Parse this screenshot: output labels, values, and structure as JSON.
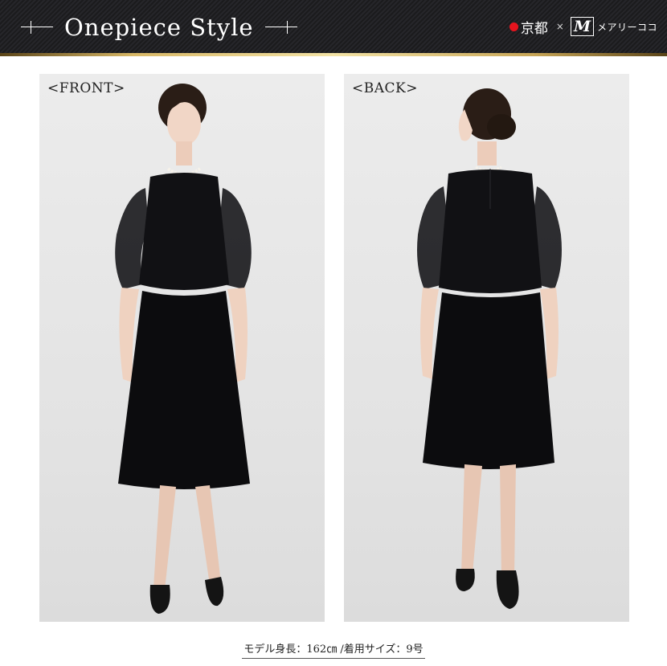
{
  "header": {
    "title": "Onepiece Style",
    "brand_city": "京都",
    "brand_separator": "×",
    "brand_logo_letter": "M",
    "brand_name": "メアリーココ"
  },
  "panels": [
    {
      "label": "<FRONT>"
    },
    {
      "label": "<BACK>"
    }
  ],
  "caption": "モデル身長：162㎝ /着用サイズ：9号",
  "colors": {
    "header_bg": "#1f1f22",
    "gold_line": "#d8b867",
    "brand_dot": "#e5141e",
    "photo_bg": "#e6e6e6",
    "dress": "#0c0c0e"
  }
}
